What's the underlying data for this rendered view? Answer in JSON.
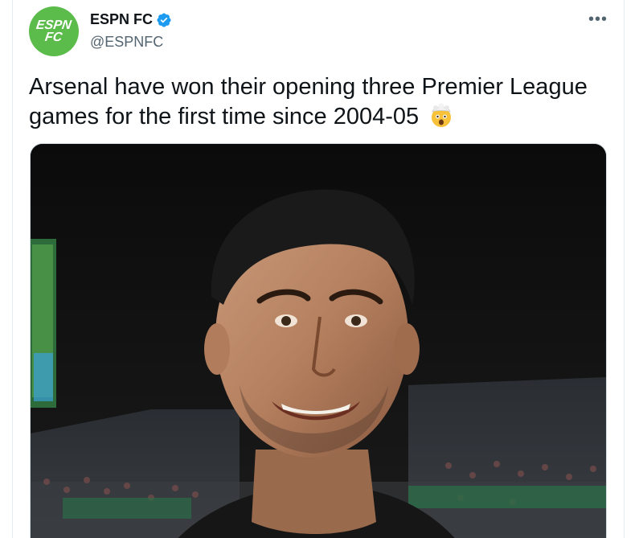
{
  "tweet": {
    "author": {
      "display_name": "ESPN FC",
      "handle": "@ESPNFC",
      "verified": true,
      "avatar_text_line1": "ESPN",
      "avatar_text_line2": "FC",
      "avatar_color": "#5cbc4b"
    },
    "more_label": "•••",
    "text": "Arsenal have won their opening three Premier League games for the first time since 2004-05",
    "emoji": "exploding-head-emoji",
    "media": {
      "type": "photo"
    }
  },
  "colors": {
    "text_primary": "#0f1419",
    "text_secondary": "#536471",
    "verified_blue": "#1d9bf0",
    "border": "#cfd9de"
  }
}
